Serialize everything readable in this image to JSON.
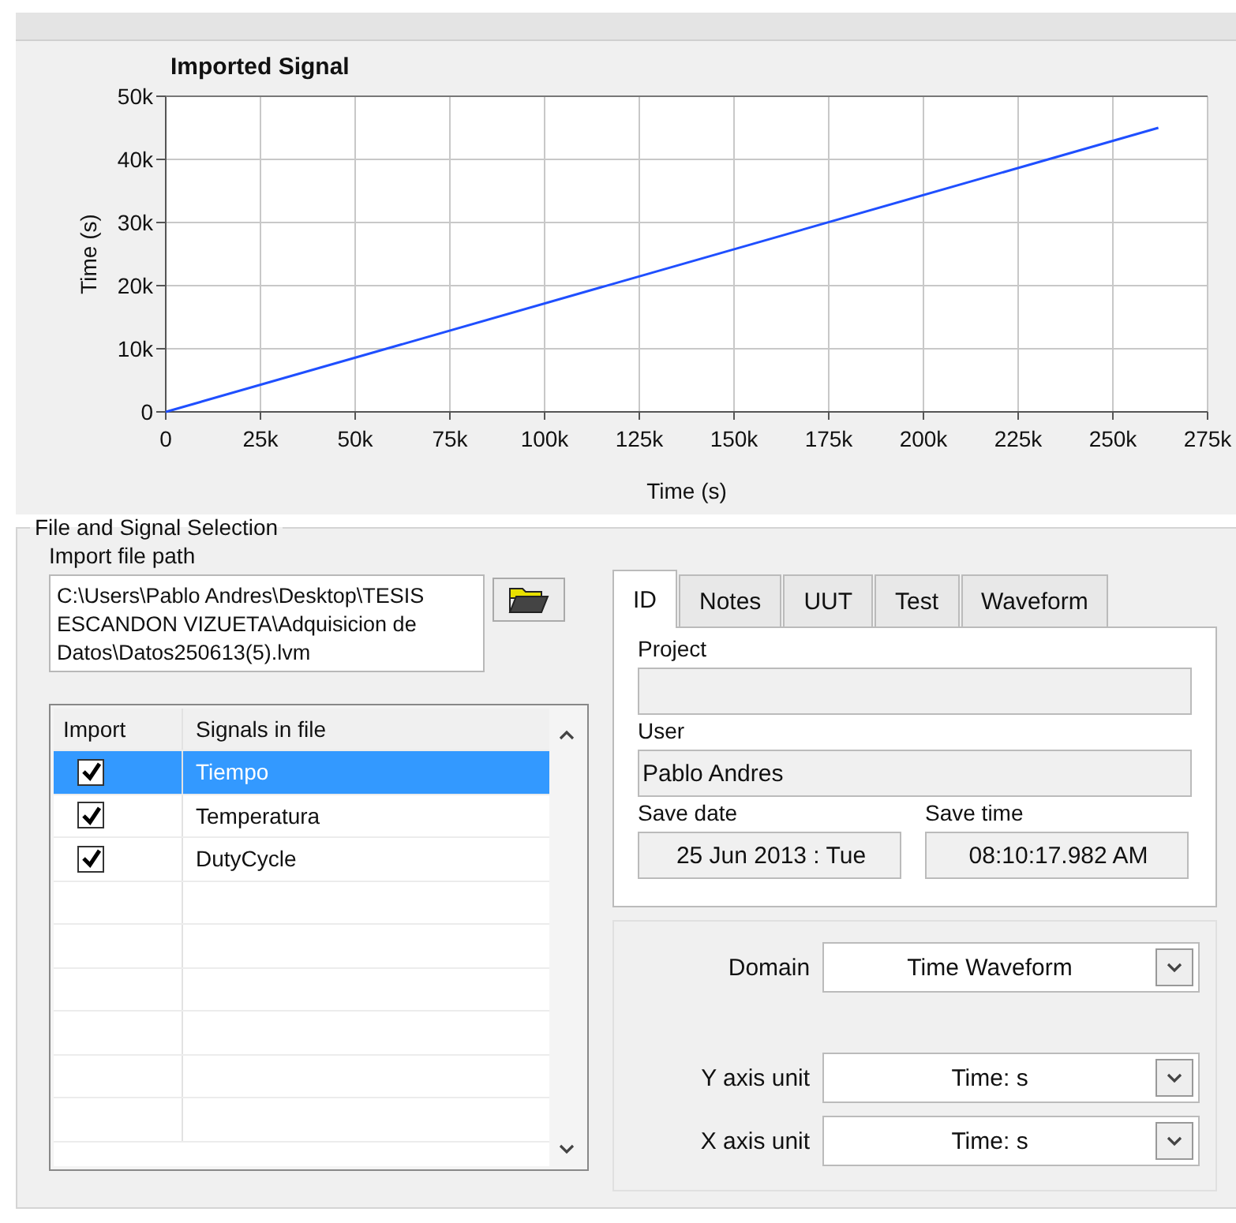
{
  "graph": {
    "chart_data": {
      "type": "line",
      "grid": true,
      "title": "Imported Signal",
      "xlabel": "Time (s)",
      "ylabel": "Time (s)",
      "x": [
        0,
        262000
      ],
      "series": [
        {
          "color": "#1f4fff",
          "values": [
            0,
            45000
          ]
        }
      ],
      "xlim": [
        0,
        275000
      ],
      "ylim": [
        0,
        50000
      ],
      "xticks": [
        {
          "value": 0,
          "label": "0"
        },
        {
          "value": 25000,
          "label": "25k"
        },
        {
          "value": 50000,
          "label": "50k"
        },
        {
          "value": 75000,
          "label": "75k"
        },
        {
          "value": 100000,
          "label": "100k"
        },
        {
          "value": 125000,
          "label": "125k"
        },
        {
          "value": 150000,
          "label": "150k"
        },
        {
          "value": 175000,
          "label": "175k"
        },
        {
          "value": 200000,
          "label": "200k"
        },
        {
          "value": 225000,
          "label": "225k"
        },
        {
          "value": 250000,
          "label": "250k"
        },
        {
          "value": 275000,
          "label": "275k"
        }
      ],
      "yticks": [
        {
          "value": 0,
          "label": "0"
        },
        {
          "value": 10000,
          "label": "10k"
        },
        {
          "value": 20000,
          "label": "20k"
        },
        {
          "value": 30000,
          "label": "30k"
        },
        {
          "value": 40000,
          "label": "40k"
        },
        {
          "value": 50000,
          "label": "50k"
        }
      ]
    }
  },
  "file_section": {
    "title": "File and Signal Selection",
    "path_label": "Import file path",
    "path_value": "C:\\Users\\Pablo Andres\\Desktop\\TESIS ESCANDON VIZUETA\\Adquisicion de Datos\\Datos250613(5).lvm",
    "signals": {
      "columns": [
        "Import",
        "Signals in file"
      ],
      "rows": [
        {
          "name": "Tiempo",
          "checked": true,
          "selected": true
        },
        {
          "name": "Temperatura",
          "checked": true,
          "selected": false
        },
        {
          "name": "DutyCycle",
          "checked": true,
          "selected": false
        }
      ]
    }
  },
  "tabs": [
    {
      "label": "ID",
      "selected": true
    },
    {
      "label": "Notes",
      "selected": false
    },
    {
      "label": "UUT",
      "selected": false
    },
    {
      "label": "Test",
      "selected": false
    },
    {
      "label": "Waveform",
      "selected": false
    }
  ],
  "id_panel": {
    "project_label": "Project",
    "user_label": "User",
    "user_value": "Pablo Andres",
    "date_label": "Save date",
    "date_value": "25 Jun 2013 : Tue",
    "time_label": "Save time",
    "time_value": "08:10:17.982 AM"
  },
  "settings": [
    {
      "label": "Domain",
      "value": "Time Waveform"
    },
    {
      "label": "Y axis unit",
      "value": "Time: s"
    },
    {
      "label": "X axis unit",
      "value": "Time: s"
    }
  ]
}
